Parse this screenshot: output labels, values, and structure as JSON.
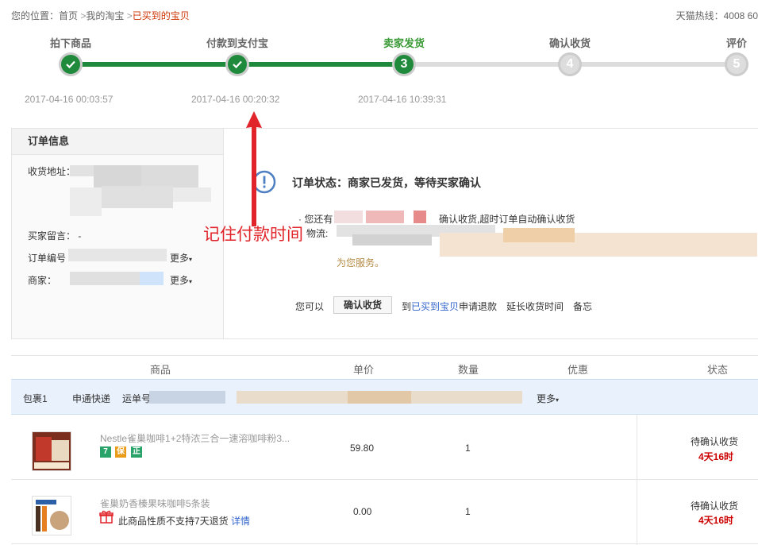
{
  "breadcrumb": {
    "prefix": "您的位置：",
    "home": "首页",
    "mytaobao": "我的淘宝",
    "current": "已买到的宝贝",
    "sep": ">"
  },
  "hotline": "天猫热线：4008 60",
  "steps": [
    {
      "label": "拍下商品",
      "state": "done",
      "time": "2017-04-16 00:03:57"
    },
    {
      "label": "付款到支付宝",
      "state": "done",
      "time": "2017-04-16 00:20:32"
    },
    {
      "label": "卖家发货",
      "state": "current",
      "number": "3",
      "time": "2017-04-16 10:39:31"
    },
    {
      "label": "确认收货",
      "state": "todo",
      "number": "4"
    },
    {
      "label": "评价",
      "state": "todo",
      "number": "5"
    }
  ],
  "annotation": "记住付款时间",
  "order_info": {
    "title": "订单信息",
    "address_label": "收货地址：",
    "message_label": "买家留言：",
    "message_value": "-",
    "order_no_label": "订单编号",
    "merchant_label": "商家：",
    "more": "更多"
  },
  "status": {
    "title": "订单状态：商家已发货，等待买家确认",
    "line1_prefix": "· 您还有",
    "line1_suffix": "确认收货,超时订单自动确认收货",
    "line2_label": "物流:",
    "line3_text": "为您服务。"
  },
  "actions": {
    "prefix": "您可以",
    "confirm": "确认收货",
    "to": "到",
    "bought_link": "已买到宝贝",
    "refund": "申请退款",
    "extend": "延长收货时间",
    "remark": "备忘"
  },
  "goods_table": {
    "headers": [
      "商品",
      "单价",
      "数量",
      "优惠",
      "状态"
    ],
    "package": {
      "label": "包裹1",
      "carrier": "申通快递",
      "tracking_label": "运单号",
      "more": "更多"
    },
    "rows": [
      {
        "name": "Nestle雀巢咖啡1+2特浓三合一速溶咖啡粉3...",
        "price": "59.80",
        "qty": "1",
        "status": "待确认收货",
        "time_left": "4天16时",
        "badges": [
          "7",
          "保",
          "正"
        ]
      },
      {
        "name": "雀巢奶香榛果味咖啡5条装",
        "price": "0.00",
        "qty": "1",
        "status": "待确认收货",
        "time_left": "4天16时",
        "note": "此商品性质不支持7天退货",
        "note_link": "详情"
      }
    ]
  },
  "colors": {
    "green": "#1f8a3b",
    "red": "#e0242a",
    "link": "#3366cc",
    "pkg_bg": "#e8f1fc"
  }
}
